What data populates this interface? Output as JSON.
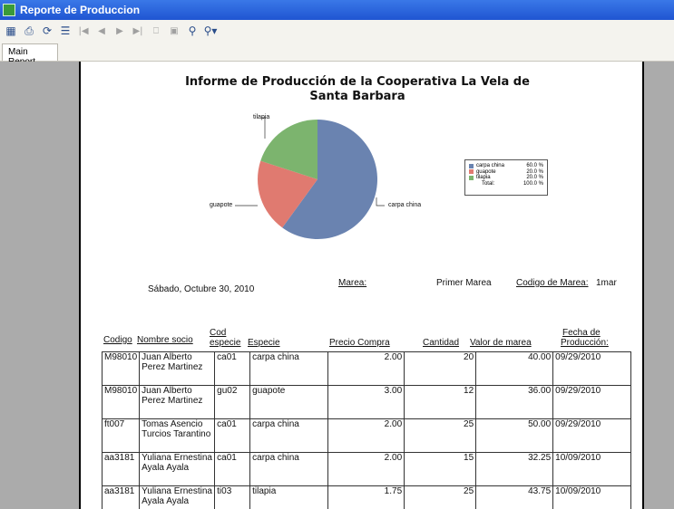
{
  "window": {
    "title": "Reporte de Produccion"
  },
  "tabs": [
    "Main Report"
  ],
  "report": {
    "title": "Informe de Producción de la Cooperativa La Vela de Santa Barbara",
    "date": "Sábado, Octubre 30, 2010",
    "marea_label": "Marea:",
    "marea_value": "Primer Marea",
    "codigo_marea_label": "Codigo de Marea:",
    "codigo_marea_value": "1mar"
  },
  "chart_data": {
    "type": "pie",
    "categories": [
      "carpa china",
      "guapote",
      "tilapia"
    ],
    "values": [
      60.0,
      20.0,
      20.0
    ],
    "colors": [
      "#6a83b0",
      "#e07a70",
      "#7cb46e"
    ],
    "legend": {
      "items": [
        {
          "name": "carpa china",
          "pct": "60.0 %"
        },
        {
          "name": "guapote",
          "pct": "20.0 %"
        },
        {
          "name": "tilapia",
          "pct": "20.0 %"
        }
      ],
      "total_label": "Total:",
      "total_pct": "100.0 %"
    }
  },
  "table": {
    "headers": {
      "codigo": "Codigo",
      "nombre": "Nombre socio",
      "cod_especie_1": "Cod",
      "cod_especie_2": "especie",
      "especie": "Especie",
      "precio": "Precio Compra",
      "cantidad": "Cantidad",
      "valor": "Valor de marea",
      "fecha_1": "Fecha de",
      "fecha_2": "Producción:"
    },
    "rows": [
      {
        "codigo": "M98010",
        "nombre": "Juan Alberto Perez Martinez",
        "cod": "ca01",
        "especie": "carpa china",
        "precio": "2.00",
        "cantidad": "20",
        "valor": "40.00",
        "fecha": "09/29/2010"
      },
      {
        "codigo": "M98010",
        "nombre": "Juan Alberto Perez Martinez",
        "cod": "gu02",
        "especie": "guapote",
        "precio": "3.00",
        "cantidad": "12",
        "valor": "36.00",
        "fecha": "09/29/2010"
      },
      {
        "codigo": "ft007",
        "nombre": "Tomas Asencio Turcios Tarantino",
        "cod": "ca01",
        "especie": "carpa china",
        "precio": "2.00",
        "cantidad": "25",
        "valor": "50.00",
        "fecha": "09/29/2010"
      },
      {
        "codigo": "aa3181",
        "nombre": "Yuliana Ernestina Ayala Ayala",
        "cod": "ca01",
        "especie": "carpa china",
        "precio": "2.00",
        "cantidad": "15",
        "valor": "32.25",
        "fecha": "10/09/2010"
      },
      {
        "codigo": "aa3181",
        "nombre": "Yuliana Ernestina Ayala Ayala",
        "cod": "ti03",
        "especie": "tilapia",
        "precio": "1.75",
        "cantidad": "25",
        "valor": "43.75",
        "fecha": "10/09/2010"
      }
    ]
  },
  "icons": [
    "export-icon",
    "print-icon",
    "refresh-icon",
    "tree-icon",
    "first-page-icon",
    "prev-page-icon",
    "next-page-icon",
    "last-page-icon",
    "goto-page-icon",
    "stop-icon",
    "search-icon",
    "zoom-icon"
  ]
}
